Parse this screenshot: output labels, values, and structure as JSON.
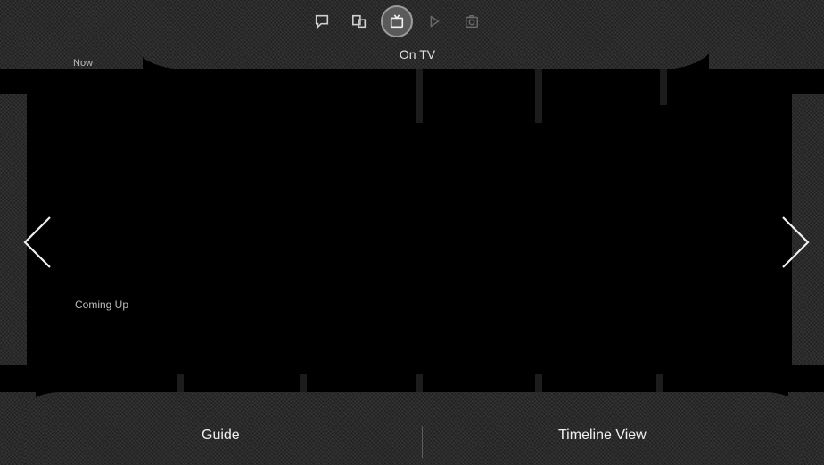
{
  "header": {
    "icons": [
      {
        "name": "chat-icon",
        "state": "normal"
      },
      {
        "name": "devices-icon",
        "state": "normal"
      },
      {
        "name": "tv-icon",
        "state": "active"
      },
      {
        "name": "play-icon",
        "state": "dim"
      },
      {
        "name": "camera-icon",
        "state": "dim"
      }
    ],
    "active_label": "On TV"
  },
  "sections": {
    "now_label": "Now",
    "coming_up_label": "Coming Up"
  },
  "navigation": {
    "prev_icon": "chevron-left-icon",
    "next_icon": "chevron-right-icon"
  },
  "footer": {
    "guide_label": "Guide",
    "timeline_label": "Timeline View"
  },
  "colors": {
    "background": "#000000",
    "band": "#2a2a2a",
    "text": "#f0f0f0"
  }
}
